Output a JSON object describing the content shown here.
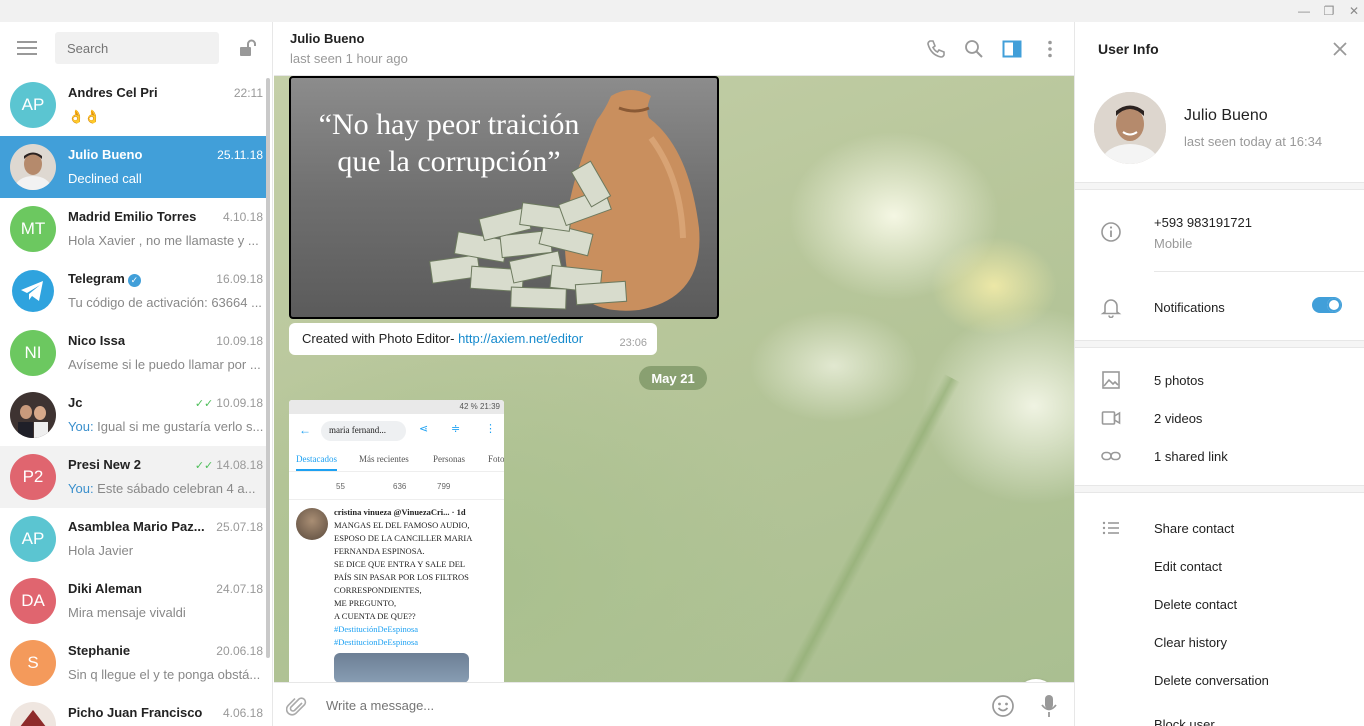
{
  "window": {
    "min_glyph": "—",
    "max_glyph": "❐",
    "close_glyph": "✕"
  },
  "search": {
    "placeholder": "Search"
  },
  "chats": [
    {
      "initials": "AP",
      "color": "#5bc5d1",
      "name": "Andres Cel Pri",
      "date": "22:11",
      "msg": "👌👌",
      "you": "",
      "checks": ""
    },
    {
      "initials": "",
      "color": "#c9b6a2",
      "name": "Julio Bueno",
      "date": "25.11.18",
      "msg": "Declined call",
      "you": "",
      "checks": ""
    },
    {
      "initials": "MT",
      "color": "#6cc860",
      "name": "Madrid Emilio Torres",
      "date": "4.10.18",
      "msg": "Hola Xavier , no me llamaste y ...",
      "you": "",
      "checks": ""
    },
    {
      "initials": "",
      "color": "#419fd9",
      "name": "Telegram",
      "date": "16.09.18",
      "msg": "Tu código de activación: 63664 ...",
      "you": "",
      "checks": ""
    },
    {
      "initials": "NI",
      "color": "#6cc860",
      "name": "Nico Issa",
      "date": "10.09.18",
      "msg": "Avíseme si le puedo llamar por ...",
      "you": "",
      "checks": ""
    },
    {
      "initials": "",
      "color": "#5b4b45",
      "name": "Jc",
      "date": "10.09.18",
      "msg": " Igual si me gustaría verlo s...",
      "you": "You:",
      "checks": "✓✓"
    },
    {
      "initials": "P2",
      "color": "#e0656f",
      "name": "Presi New 2",
      "date": "14.08.18",
      "msg": " Este sábado celebran 4 a...",
      "you": "You:",
      "checks": "✓✓"
    },
    {
      "initials": "AP",
      "color": "#5bc5d1",
      "name": "Asamblea Mario Paz...",
      "date": "25.07.18",
      "msg": "Hola Javier",
      "you": "",
      "checks": ""
    },
    {
      "initials": "DA",
      "color": "#e0656f",
      "name": "Diki Aleman",
      "date": "24.07.18",
      "msg": "Mira mensaje vivaldi",
      "you": "",
      "checks": ""
    },
    {
      "initials": "S",
      "color": "#f49a5b",
      "name": "Stephanie",
      "date": "20.06.18",
      "msg": "Sin q llegue el y te ponga obstá...",
      "you": "",
      "checks": ""
    },
    {
      "initials": "",
      "color": "#8e2b2b",
      "name": "Picho Juan Francisco",
      "date": "4.06.18",
      "msg": "",
      "you": "",
      "checks": ""
    }
  ],
  "header": {
    "name": "Julio Bueno",
    "status": "last seen 1 hour ago"
  },
  "messages": {
    "quote_line1": "“No hay peor traición",
    "quote_line2": "que la corrupción”",
    "caption_text": "Created with Photo Editor- ",
    "caption_link": "http://axiem.net/editor",
    "caption_time": "23:06",
    "date_pill": "May 21"
  },
  "screenshot_tweet": {
    "status_bar": "42 %  21:39",
    "search_chip": "maria fernand...",
    "tabs": [
      "Destacados",
      "Más recientes",
      "Personas",
      "Foto"
    ],
    "counts": [
      "55",
      "636",
      "799"
    ],
    "author": "cristina vinueza @VinuezaCri... · 1d",
    "lines": [
      "MANGAS EL DEL FAMOSO AUDIO,",
      "ESPOSO DE LA CANCILLER MARIA",
      "FERNANDA ESPINOSA.",
      "SE DICE QUE ENTRA Y SALE DEL",
      "PAÍS SIN PASAR POR LOS FILTROS",
      "CORRESPONDIENTES,",
      "ME PREGUNTO,",
      "A CUENTA DE QUE??"
    ],
    "hashtags": [
      "#DestituciónDeEspinosa",
      "#DestitucionDeEspinosa"
    ]
  },
  "composer": {
    "placeholder": "Write a message..."
  },
  "user_info": {
    "title": "User Info",
    "name": "Julio Bueno",
    "status": "last seen today at 16:34",
    "phone": "+593 983191721",
    "phone_label": "Mobile",
    "notifications": "Notifications",
    "notifications_on": true,
    "photos": "5 photos",
    "videos": "2 videos",
    "links": "1 shared link",
    "actions": [
      "Share contact",
      "Edit contact",
      "Delete contact",
      "Clear history",
      "Delete conversation",
      "Block user"
    ]
  },
  "colors": {
    "accent": "#419fd9",
    "check": "#4dbe59",
    "link": "#168acd"
  }
}
